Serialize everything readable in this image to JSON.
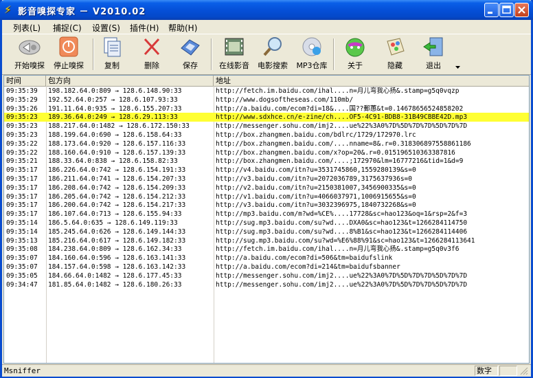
{
  "window": {
    "title": "影音嗅探专家 － V2010.02"
  },
  "menu": [
    "列表(L)",
    "捕捉(C)",
    "设置(S)",
    "插件(H)",
    "帮助(H)"
  ],
  "toolbar": [
    {
      "label": "开始嗅探",
      "icon": "start-sniff-icon"
    },
    {
      "label": "停止嗅探",
      "icon": "stop-sniff-icon"
    },
    {
      "label": "复制",
      "icon": "copy-icon"
    },
    {
      "label": "删除",
      "icon": "delete-icon"
    },
    {
      "label": "保存",
      "icon": "save-icon"
    },
    {
      "label": "在线影音",
      "icon": "film-icon"
    },
    {
      "label": "电影搜索",
      "icon": "magnifier-icon"
    },
    {
      "label": "MP3仓库",
      "icon": "cd-icon"
    },
    {
      "label": "关于",
      "icon": "about-icon"
    },
    {
      "label": "隐藏",
      "icon": "hide-icon"
    },
    {
      "label": "退出",
      "icon": "exit-icon"
    }
  ],
  "table": {
    "columns": [
      "时间",
      "包方向",
      "地址"
    ],
    "rows": [
      {
        "time": "09:35:39",
        "dir": "198.182.64.0:809 → 128.6.148.90:33",
        "url": "http://fetch.im.baidu.com/ihal....n=月儿弯我心扬&.stamp=g5q0vqzp"
      },
      {
        "time": "09:35:29",
        "dir": "192.52.64.0:257 → 128.6.107.93:33",
        "url": "http://www.dogsoftheseas.com/110mb/"
      },
      {
        "time": "09:35:26",
        "dir": "191.11.64.0:935 → 128.6.155.207:33",
        "url": "http://a.baidu.com/ecom?di=18&....国??郵蕙&t=0.14678656524858202"
      },
      {
        "time": "09:35:23",
        "dir": "189.36.64.0:249 → 128.6.29.113:33",
        "url": "http://www.sdxhce.cn/e-zine/ch....OF5-4C91-BDB8-31B49CBBE42D.mp3",
        "selected": true
      },
      {
        "time": "09:35:23",
        "dir": "188.217.64.0:1482 → 128.6.172.150:33",
        "url": "http://messenger.sohu.com/imj2....ue%22%3A0%7D%5D%7D%7D%5D%7D%7D"
      },
      {
        "time": "09:35:23",
        "dir": "188.199.64.0:690 → 128.6.158.64:33",
        "url": "http://box.zhangmen.baidu.com/bdlrc/1729/172970.lrc"
      },
      {
        "time": "09:35:22",
        "dir": "188.173.64.0:920 → 128.6.157.116:33",
        "url": "http://box.zhangmen.baidu.com/....nname=8&.r=0.318306897558861186"
      },
      {
        "time": "09:35:22",
        "dir": "188.160.64.0:910 → 128.6.157.139:33",
        "url": "http://box.zhangmen.baidu.com/x?op=20&.r=0.015196510363387816"
      },
      {
        "time": "09:35:21",
        "dir": "188.33.64.0:838 → 128.6.158.82:33",
        "url": "http://box.zhangmen.baidu.com/....;172970&lm=16777216&tid=1&d=9"
      },
      {
        "time": "09:35:17",
        "dir": "186.226.64.0:742 → 128.6.154.191:33",
        "url": "http://v4.baidu.com/itn?u=3531745860,1559280139&s=0"
      },
      {
        "time": "09:35:17",
        "dir": "186.211.64.0:741 → 128.6.154.207:33",
        "url": "http://v3.baidu.com/itn?u=2072036789,3175637936s=0"
      },
      {
        "time": "09:35:17",
        "dir": "186.208.64.0:742 → 128.6.154.209:33",
        "url": "http://v2.baidu.com/itn?u=2150381007,3456900335&s=0"
      },
      {
        "time": "09:35:17",
        "dir": "186.205.64.0:742 → 128.6.154.212:33",
        "url": "http://v1.baidu.com/itn?u=4066037971,1006915655&s=0"
      },
      {
        "time": "09:35:17",
        "dir": "186.200.64.0:742 → 128.6.154.217:33",
        "url": "http://v3.baidu.com/itn?u=3032396975,1840732268&s=0"
      },
      {
        "time": "09:35:17",
        "dir": "186.107.64.0:713 → 128.6.155.94:33",
        "url": "http://mp3.baidu.com/m?wd=%CE%....17728&sc=hao123&oq=1&rsp=2&f=3"
      },
      {
        "time": "09:35:14",
        "dir": "186.5.64.0:635 → 128.6.149.119:33",
        "url": "http://sug.mp3.baidu.com/su?wd....DXA0&sc=hao123&t=1266284114750"
      },
      {
        "time": "09:35:14",
        "dir": "185.245.64.0:626 → 128.6.149.144:33",
        "url": "http://sug.mp3.baidu.com/su?wd....8%B1&sc=hao123&t=1266284114406"
      },
      {
        "time": "09:35:13",
        "dir": "185.216.64.0:617 → 128.6.149.182:33",
        "url": "http://sug.mp3.baidu.com/su?wd=%E6%88%91&sc=hao123&t=1266284113641"
      },
      {
        "time": "09:35:08",
        "dir": "184.238.64.0:809 → 128.6.162.34:33",
        "url": "http://fetch.im.baidu.com/ihal....n=月儿弯我心扬&.stamp=g5q0v3f6"
      },
      {
        "time": "09:35:07",
        "dir": "184.160.64.0:596 → 128.6.163.141:33",
        "url": "http://a.baidu.com/ecom?di=506&tm=baidufslink"
      },
      {
        "time": "09:35:07",
        "dir": "184.157.64.0:598 → 128.6.163.142:33",
        "url": "http://a.baidu.com/ecom?di=214&tm=baidufsbanner"
      },
      {
        "time": "09:35:05",
        "dir": "184.66.64.0:1482 → 128.6.177.45:33",
        "url": "http://messenger.sohu.com/imj2....ue%22%3A0%7D%5D%7D%7D%5D%7D%7D"
      },
      {
        "time": "09:34:47",
        "dir": "181.85.64.0:1482 → 128.6.180.26:33",
        "url": "http://messenger.sohu.com/imj2....ue%22%3A0%7D%5D%7D%7D%5D%7D%7D"
      }
    ]
  },
  "status": {
    "text": "Msniffer",
    "mode": "数字"
  }
}
